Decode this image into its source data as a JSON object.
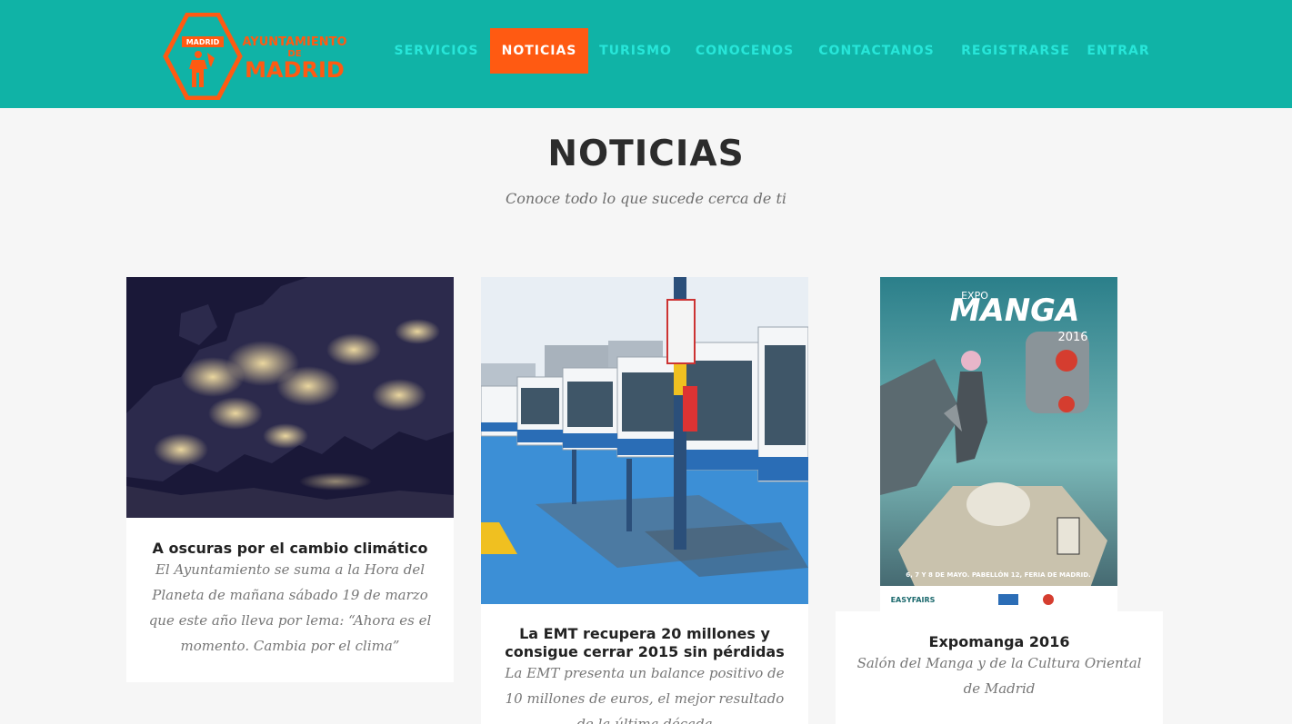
{
  "brand": {
    "logo_small": "MADRID",
    "logo_line1": "AYUNTAMIENTO",
    "logo_line2": "DE",
    "logo_line3": "MADRID",
    "accent": "#ff5a12",
    "header_bg": "#10b3a6"
  },
  "nav": {
    "items": [
      {
        "label": "SERVICIOS",
        "active": false
      },
      {
        "label": "NOTICIAS",
        "active": true
      },
      {
        "label": "TURISMO",
        "active": false
      },
      {
        "label": "CONOCENOS",
        "active": false
      },
      {
        "label": "CONTACTANOS",
        "active": false
      },
      {
        "label": "REGISTRARSE",
        "active": false
      },
      {
        "label": "ENTRAR",
        "active": false
      }
    ]
  },
  "page": {
    "title": "NOTICIAS",
    "subtitle": "Conoce todo lo que sucede cerca de ti"
  },
  "news": [
    {
      "title": "A oscuras por el cambio climático",
      "text": "El Ayuntamiento se suma a la Hora del Planeta de mañana sábado 19 de marzo que este año lleva por lema: “Ahora es el momento. Cambia por el clima”"
    },
    {
      "title": "La EMT recupera 20 millones y consigue cerrar 2015 sin pérdidas",
      "text": "La EMT presenta un balance positivo de 10 millones de euros, el mejor resultado de la última década"
    },
    {
      "title": "Expomanga 2016",
      "text": "Salón del Manga y de la Cultura Oriental de Madrid",
      "poster_title": "MANGA",
      "poster_prefix": "EXPO",
      "poster_year": "2016",
      "poster_dates": "6, 7 Y 8 DE MAYO. PABELLÓN 12, FERIA DE MADRID.",
      "poster_sponsor": "EASYFAIRS"
    }
  ]
}
